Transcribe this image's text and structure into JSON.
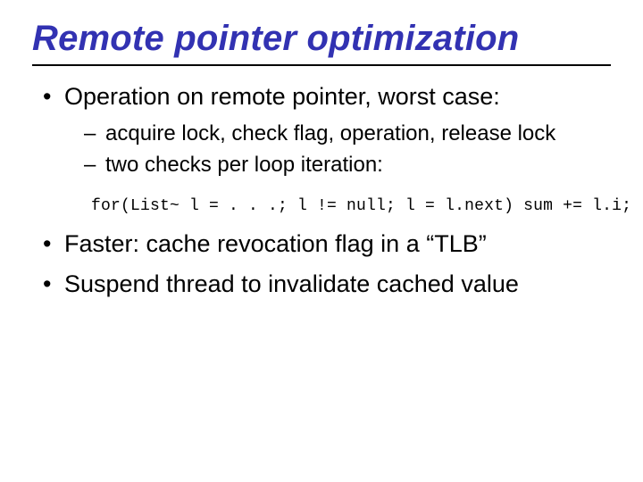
{
  "title": "Remote pointer optimization",
  "bullets": {
    "b1": {
      "text": "Operation on remote pointer, worst case:",
      "sub": {
        "s1": "acquire lock, check flag, operation, release lock",
        "s2": "two checks per loop iteration:"
      }
    },
    "code": "for(List~ l = . . .; l != null; l = l.next) sum += l.i;",
    "b2": {
      "text": "Faster: cache revocation flag in a “TLB”"
    },
    "b3": {
      "text": "Suspend thread to invalidate cached value"
    }
  }
}
